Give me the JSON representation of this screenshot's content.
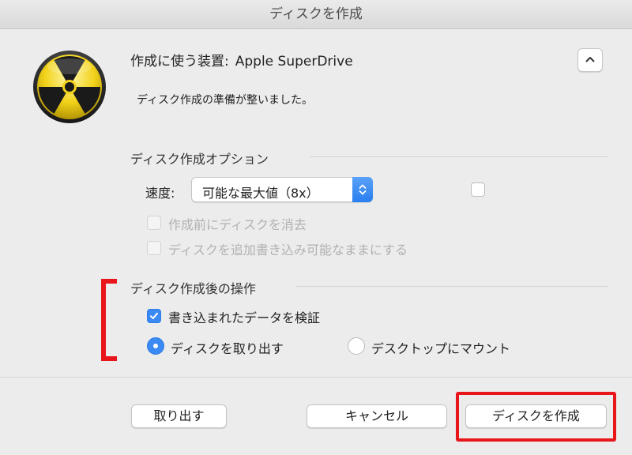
{
  "window": {
    "title": "ディスクを作成"
  },
  "device": {
    "label": "作成に使う装置:",
    "name": "Apple SuperDrive"
  },
  "status": {
    "text": "ディスク作成の準備が整いました。"
  },
  "options": {
    "heading": "ディスク作成オプション",
    "speed_label": "速度:",
    "speed_value": "可能な最大値（8x）",
    "erase_label": "作成前にディスクを消去",
    "appendable_label": "ディスクを追加書き込み可能なままにする"
  },
  "after": {
    "heading": "ディスク作成後の操作",
    "verify_label": "書き込まれたデータを検証",
    "verify_checked": true,
    "eject_label": "ディスクを取り出す",
    "mount_label": "デスクトップにマウント",
    "selected": "eject"
  },
  "buttons": {
    "eject": "取り出す",
    "cancel": "キャンセル",
    "burn": "ディスクを作成"
  },
  "icons": {
    "burn": "radiation-icon",
    "collapse": "chevron-up-icon",
    "stepper": "up-down-stepper-icon",
    "check": "checkmark-icon"
  },
  "colors": {
    "accent": "#3b8af4",
    "annotation_red": "#e8151b",
    "icon_yellow": "#f5d820"
  }
}
